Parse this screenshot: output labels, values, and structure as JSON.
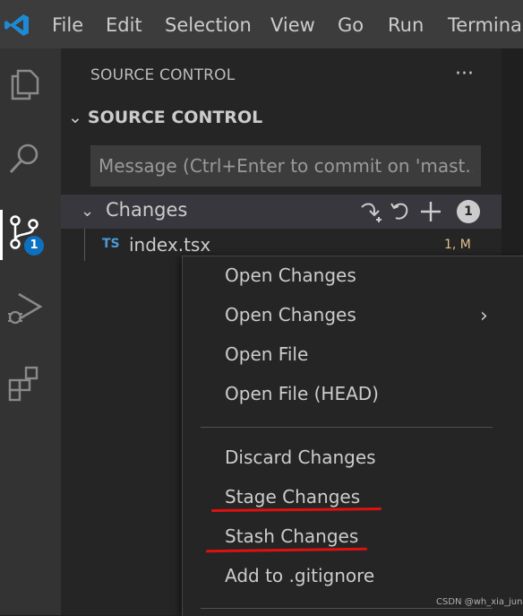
{
  "menubar": {
    "items": [
      "File",
      "Edit",
      "Selection",
      "View",
      "Go",
      "Run",
      "Terminal"
    ]
  },
  "activity_bar": {
    "icons": [
      "explorer-icon",
      "search-icon",
      "source-control-icon",
      "run-debug-icon",
      "extensions-icon"
    ],
    "source_control_badge": "1"
  },
  "sidebar": {
    "title": "SOURCE CONTROL",
    "more_actions": "···",
    "section_header": "SOURCE CONTROL",
    "commit_placeholder": "Message (Ctrl+Enter to commit on 'mast...",
    "changes": {
      "label": "Changes",
      "count": "1",
      "actions": [
        "open-changes-icon",
        "discard-icon",
        "stage-icon"
      ]
    },
    "file": {
      "type_badge": "TS",
      "name": "index.tsx",
      "status": "1, M"
    }
  },
  "context_menu": {
    "items": [
      "Open Changes",
      "Open Changes",
      "Open File",
      "Open File (HEAD)",
      "Discard Changes",
      "Stage Changes",
      "Stash Changes",
      "Add to .gitignore"
    ],
    "submenu_arrow": "›",
    "highlight_color": "#e01010"
  },
  "watermark": "CSDN @wh_xia_jun"
}
